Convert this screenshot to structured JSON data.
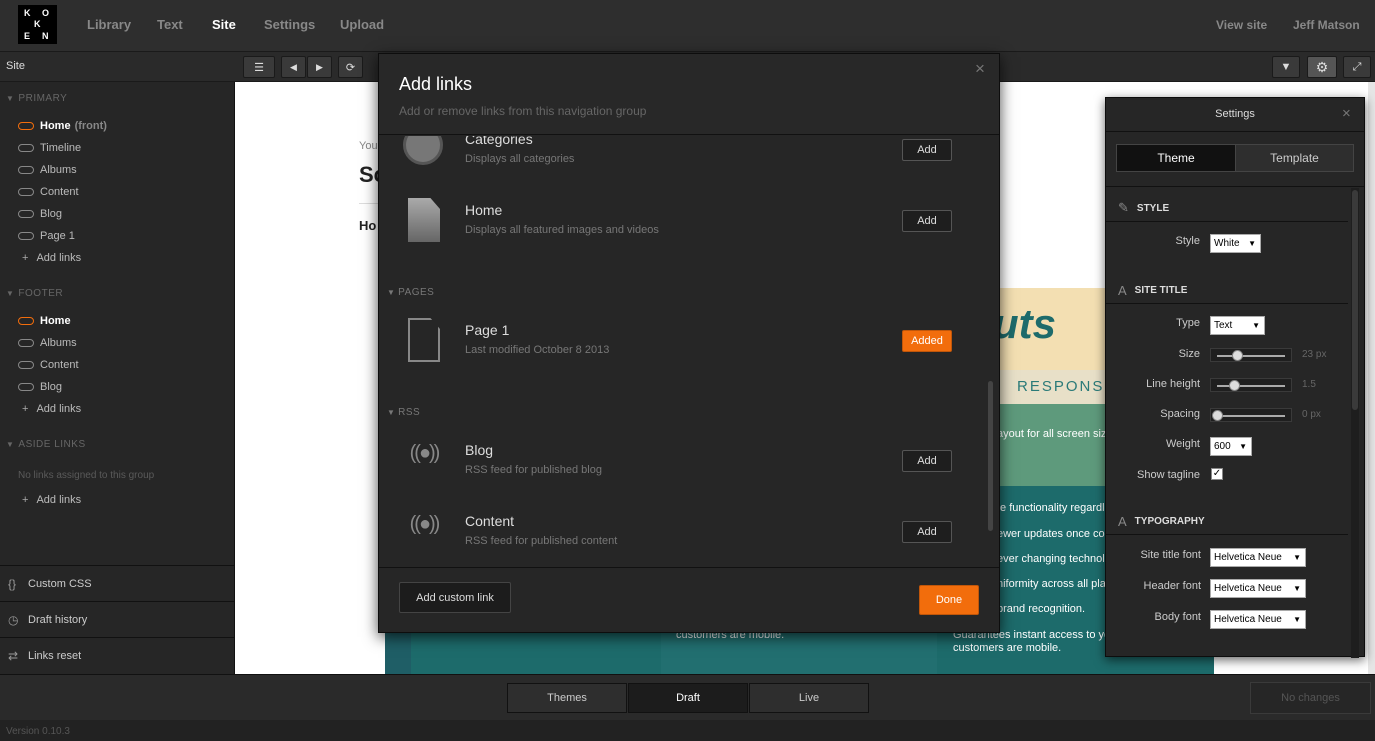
{
  "logo": {
    "letters": [
      "K",
      "O",
      "K",
      "O",
      "E",
      "N"
    ]
  },
  "nav": {
    "items": [
      "Library",
      "Text",
      "Site",
      "Settings",
      "Upload"
    ],
    "active": "Site",
    "view_site": "View site",
    "user": "Jeff Matson"
  },
  "toolbar": {
    "site_label": "Site"
  },
  "sidebar": {
    "primary": {
      "title": "PRIMARY",
      "items": [
        "Home",
        "Timeline",
        "Albums",
        "Content",
        "Blog",
        "Page 1"
      ],
      "front_label": "(front)",
      "add": "Add links"
    },
    "footer": {
      "title": "FOOTER",
      "items": [
        "Home",
        "Albums",
        "Content",
        "Blog"
      ],
      "add": "Add links"
    },
    "aside": {
      "title": "ASIDE LINKS",
      "empty": "No links assigned to this group",
      "add": "Add links"
    },
    "bottom": [
      "Custom CSS",
      "Draft history",
      "Links reset"
    ]
  },
  "preview": {
    "you": "You",
    "big": "Sc",
    "ho": "Ho",
    "brand": "uts",
    "respons": "RESPONS",
    "layout": "ayout for all screen size",
    "lines": [
      "te functionality regardle",
      "ewer updates once cod",
      "ever changing technolo",
      "niformity across all platf",
      "brand recognition."
    ],
    "left_col": "customers are mobile.",
    "right_col1": "Guarantees instant access to you",
    "right_col2": "customers are mobile."
  },
  "modal": {
    "title": "Add links",
    "subtitle": "Add or remove links from this navigation group",
    "rows": [
      {
        "title": "Categories",
        "desc": "Displays all categories",
        "button": "Add"
      },
      {
        "title": "Home",
        "desc": "Displays all featured images and videos",
        "button": "Add"
      },
      {
        "title": "Page 1",
        "desc": "Last modified October 8 2013",
        "button": "Added"
      },
      {
        "title": "Blog",
        "desc": "RSS feed for published blog",
        "button": "Add"
      },
      {
        "title": "Content",
        "desc": "RSS feed for published content",
        "button": "Add"
      }
    ],
    "groups": [
      "PAGES",
      "RSS"
    ],
    "custom_link": "Add custom link",
    "done": "Done",
    "close": "×"
  },
  "settings": {
    "title": "Settings",
    "close": "×",
    "tabs": [
      "Theme",
      "Template"
    ],
    "style_head": "STYLE",
    "style_label": "Style",
    "style_value": "White",
    "site_title_head": "SITE TITLE",
    "type_label": "Type",
    "type_value": "Text",
    "size_label": "Size",
    "size_value": "23 px",
    "size_level": 0.3,
    "lineheight_label": "Line height",
    "lineheight_value": "1.5",
    "lineheight_level": 0.25,
    "spacing_label": "Spacing",
    "spacing_value": "0 px",
    "spacing_level": 0.0,
    "weight_label": "Weight",
    "weight_value": "600",
    "tagline_label": "Show tagline",
    "tagline_checked": true,
    "typography_head": "TYPOGRAPHY",
    "site_title_font_label": "Site title font",
    "header_font_label": "Header font",
    "body_font_label": "Body font",
    "font_value": "Helvetica Neue"
  },
  "bottom": {
    "segments": [
      "Themes",
      "Draft",
      "Live"
    ],
    "active": "Draft",
    "no_changes": "No changes"
  },
  "version": "Version 0.10.3",
  "colors": {
    "accent": "#f26d0c",
    "teal": "#1d6b6b",
    "green": "#5e9a7c",
    "cream": "#f3dfb2"
  }
}
